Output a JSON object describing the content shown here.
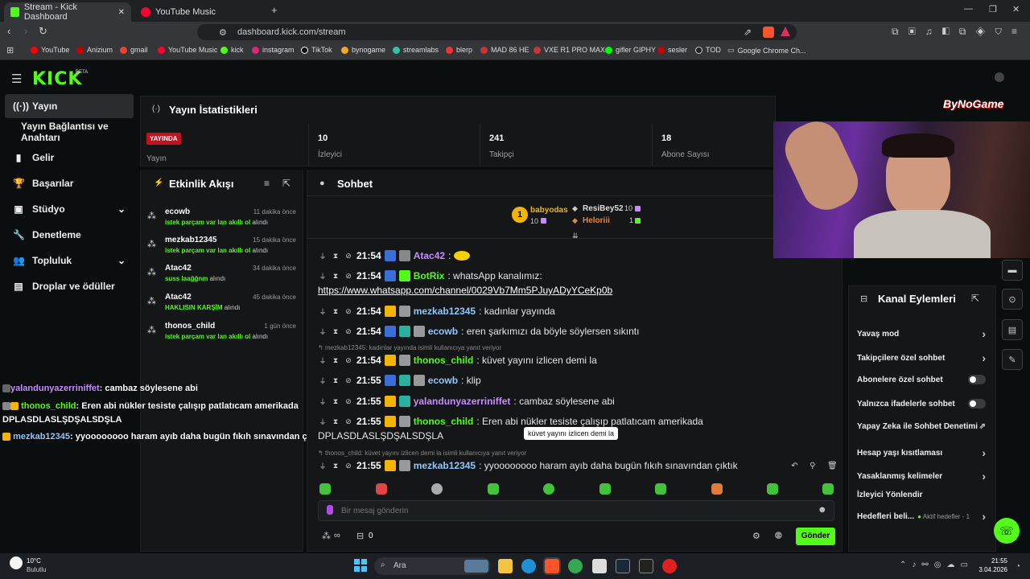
{
  "browser": {
    "tabs": [
      {
        "title": "Stream - Kick Dashboard",
        "close": "✕"
      },
      {
        "title": "YouTube Music"
      }
    ],
    "url": "dashboard.kick.com/stream",
    "new_tab": "+"
  },
  "bookmarks": [
    "YouTube",
    "Anizium",
    "gmail",
    "YouTube Music",
    "kick",
    "instagram",
    "TikTok",
    "bynogame",
    "streamlabs",
    "blerp",
    "MAD 86 HE",
    "VXE R1 PRO MAX",
    "gifler GIPHY",
    "sesler",
    "TOD",
    "Google Chrome Ch..."
  ],
  "app": {
    "logo": "KICK",
    "logo_beta": "BETA"
  },
  "sidebar": {
    "items": [
      {
        "label": "Yayın",
        "icon": "((·))"
      },
      {
        "label": "Yayın Bağlantısı ve Anahtarı"
      },
      {
        "label": "Gelir",
        "icon": "▮"
      },
      {
        "label": "Başarılar",
        "icon": "🏆"
      },
      {
        "label": "Stüdyo",
        "icon": "▣",
        "chev": "⌄"
      },
      {
        "label": "Denetleme",
        "icon": "🔧"
      },
      {
        "label": "Topluluk",
        "icon": "👥",
        "chev": "⌄"
      },
      {
        "label": "Droplar ve ödüller",
        "icon": "▤"
      }
    ]
  },
  "stats": {
    "title": "Yayın İstatistikleri",
    "live_badge": "YAYINDA",
    "live_label": "Yayın",
    "viewers": "10",
    "viewers_label": "İzleyici",
    "followers": "241",
    "followers_label": "Takipçi",
    "subs": "18",
    "subs_label": "Abone Sayısı"
  },
  "events": {
    "title": "Etkinlik Akışı",
    "items": [
      {
        "name": "ecowb",
        "time": "11 dakika önce",
        "item": "istek parçam var lan akıllı ol",
        "suffix": "alındı"
      },
      {
        "name": "mezkab12345",
        "time": "15 dakika önce",
        "item": "istek parçam var lan akıllı ol",
        "suffix": "alındı"
      },
      {
        "name": "Atac42",
        "time": "34 dakika önce",
        "item": "suss laağğnm",
        "suffix": "alındı"
      },
      {
        "name": "Atac42",
        "time": "45 dakika önce",
        "item": "HAKLISIN KARŞİM",
        "suffix": "alındı"
      },
      {
        "name": "thonos_child",
        "time": "1 gün önce",
        "item": "istek parçam var lan akıllı ol",
        "suffix": "alındı"
      }
    ]
  },
  "overlay_chat": [
    {
      "user": "yalandunyazerriniffet",
      "text": ": cambaz söylesene abi",
      "color": "#c78cff"
    },
    {
      "user": "thonos_child",
      "text": ": Eren abi nükler tesiste çalışıp patlatıcam amerikada",
      "color": "#53fc18"
    },
    {
      "text2": "DPLASDLASLŞDŞALSDŞLA"
    },
    {
      "user": "mezkab12345",
      "text": ": yyoooooooo haram ayıb daha bugün fıkıh sınavından çıktık",
      "color": "#8fc8ff"
    }
  ],
  "chat": {
    "title": "Sohbet",
    "leaders": [
      {
        "name": "babyodas",
        "value": "10"
      },
      {
        "name": "ResiBey52",
        "value": "10"
      },
      {
        "name": "Heloriii",
        "value": "1"
      }
    ],
    "messages": [
      {
        "time": "21:54",
        "user": "Atac42",
        "color": "#c78cff",
        "text": ":"
      },
      {
        "time": "21:54",
        "user": "BotRix",
        "color": "#53fc18",
        "text": ": whatsApp kanalımız:",
        "link": "https://www.whatsapp.com/channel/0029Vb7Mm5PJuyADyYCeKp0b"
      },
      {
        "time": "21:54",
        "user": "mezkab12345",
        "color": "#8fc8ff",
        "text": ": kadınlar yayında"
      },
      {
        "time": "21:54",
        "user": "ecowb",
        "color": "#8fc8ff",
        "text": ": eren şarkımızı da böyle söylersen sıkıntı"
      },
      {
        "reply": "mezkab12345: kadınlar yayında isimli kullanıcıya yanıt veriyor"
      },
      {
        "time": "21:54",
        "user": "thonos_child",
        "color": "#53fc18",
        "text": ": küvet yayını izlicen demi la"
      },
      {
        "time": "21:55",
        "user": "ecowb",
        "color": "#8fc8ff",
        "text": ": klip"
      },
      {
        "time": "21:55",
        "user": "yalandunyazerriniffet",
        "color": "#c78cff",
        "text": ": cambaz söylesene abi"
      },
      {
        "time": "21:55",
        "user": "thonos_child",
        "color": "#53fc18",
        "text": ": Eren abi nükler tesiste çalışıp patlatıcam amerikada",
        "cont": "DPLASDLASLŞDŞALSDŞLA"
      },
      {
        "reply": "thonos_child: küvet yayını izlicen demi la isimli kullanıcıya yanıt veriyor"
      },
      {
        "time": "21:55",
        "user": "mezkab12345",
        "color": "#8fc8ff",
        "text": ": yyoooooooo haram ayıb daha bugün fıkıh sınavından çıktık"
      }
    ],
    "tooltip": "küvet yayını izlicen demi la",
    "input_placeholder": "Bir mesaj gönderin",
    "send": "Gönder",
    "footer_count": "0",
    "infinity": "∞"
  },
  "actions": {
    "title": "Kanal Eylemleri",
    "rows": [
      {
        "label": "Yavaş mod",
        "type": "chev"
      },
      {
        "label": "Takipçilere özel sohbet",
        "type": "chev"
      },
      {
        "label": "Abonelere özel sohbet",
        "type": "toggle"
      },
      {
        "label": "Yalnızca ifadelerle sohbet",
        "type": "toggle"
      },
      {
        "label": "Yapay Zeka ile Sohbet Denetimi",
        "type": "ext"
      },
      {
        "label": "Hesap yaşı kısıtlaması",
        "type": "chev"
      },
      {
        "label": "Yasaklanmış kelimeler",
        "type": "chev"
      },
      {
        "label": "İzleyici Yönlendir",
        "type": "none"
      },
      {
        "label": "Hedefleri beli...",
        "type": "chev",
        "extra": "Aktif hedefler - 1"
      }
    ]
  },
  "webcam": {
    "brand": "ByNoGame"
  },
  "taskbar": {
    "weather_temp": "10°C",
    "weather_desc": "Bulutlu",
    "search": "Ara",
    "time": "21:55",
    "date": "3.04.2026"
  }
}
